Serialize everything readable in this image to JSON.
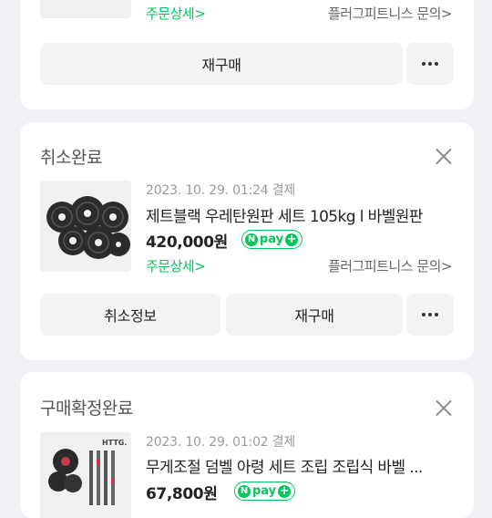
{
  "card1": {
    "detail_link": "주문상세>",
    "store_link": "플러그피트니스 문의>",
    "repurchase_button": "재구매"
  },
  "card2": {
    "status": "취소완료",
    "date": "2023. 10. 29. 01:24 결제",
    "title": "제트블랙 우레탄원판 세트 105kg l 바벨원판",
    "price": "420,000원",
    "npay_label": "pay",
    "detail_link": "주문상세>",
    "store_link": "플러그피트니스 문의>",
    "cancel_info_button": "취소정보",
    "repurchase_button": "재구매"
  },
  "card3": {
    "status": "구매확정완료",
    "date": "2023. 10. 29. 01:02 결제",
    "title": "무게조절 덤벨 아령 세트 조립 조립식 바벨 ...",
    "price": "67,800원",
    "npay_label": "pay",
    "brand_mark": "HTTG."
  },
  "colors": {
    "accent": "#03c75a",
    "background": "#eff1f4"
  }
}
